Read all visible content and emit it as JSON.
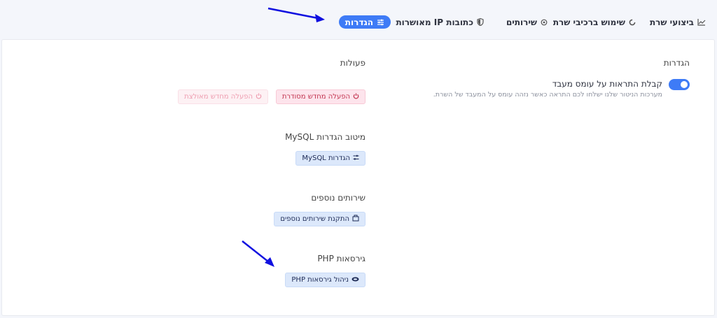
{
  "tabs": [
    {
      "label": "ביצועי שרת",
      "icon": "chart-line-icon",
      "active": false
    },
    {
      "label": "שימוש ברכיבי שרת",
      "icon": "refresh-icon",
      "active": false
    },
    {
      "label": "שירותים",
      "icon": "gear-icon",
      "active": false
    },
    {
      "label": "כתובות IP מאושרות",
      "icon": "shield-icon",
      "active": false
    },
    {
      "label": "הגדרות",
      "icon": "sliders-icon",
      "active": true
    }
  ],
  "settings": {
    "title": "הגדרות",
    "toggle_label": "קבלת התראות על עומס מעבד",
    "toggle_desc": "מערכות הניטור שלנו ישלחו לכם התראה כאשר נזהה עומס על המעבד של השרת.",
    "toggle_on": true
  },
  "actions": {
    "title": "פעולות",
    "soft_restart_label": "הפעלה מחדש מסודרת",
    "hard_restart_label": "הפעלה מחדש מאולצת"
  },
  "mysql": {
    "title": "מיטוב הגדרות MySQL",
    "button_label": "הגדרות MySQL"
  },
  "extra_services": {
    "title": "שירותים נוספים",
    "button_label": "התקנת שירותים נוספים"
  },
  "php": {
    "title": "גירסאות PHP",
    "button_label": "ניהול גירסאות PHP"
  },
  "colors": {
    "accent": "#3e7bf6",
    "annotation_arrow": "#1010e0",
    "danger": "#c2334f"
  }
}
